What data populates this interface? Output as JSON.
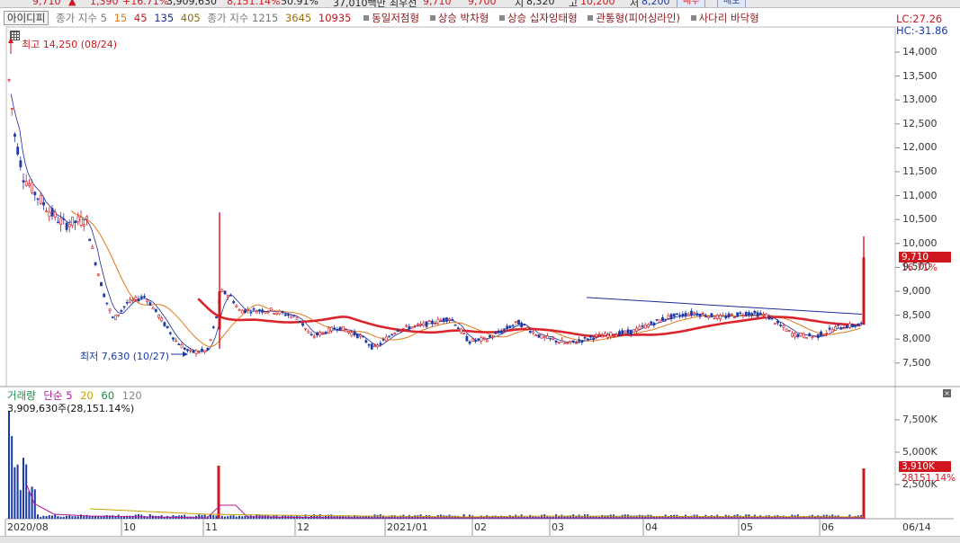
{
  "topbar": {
    "price": "9,710",
    "change": "1,390",
    "change_pct": "+16.71%",
    "volume": "3,909,630",
    "volume_pct": "8,151.14%",
    "ratio": "50.91%",
    "amount": "37,010백만",
    "label_price": "최우선",
    "ask": "9,710",
    "bid": "9,700",
    "open_label": "시",
    "open": "8,320",
    "high_label": "고",
    "high": "10,200",
    "low_label": "저",
    "low": "8,200",
    "buy_btn": "매수",
    "sell_btn": "매도"
  },
  "legend": {
    "tab": "아이디피",
    "ma_label": "종가 지수 5",
    "ma": [
      "15",
      "45",
      "135",
      "405"
    ],
    "ma2_label": "종가 지수 1215",
    "ma2": [
      "3645",
      "10935"
    ],
    "patterns": [
      "동일저점형",
      "상승 박차형",
      "상승 십자잉태형",
      "관통형(피어싱라인)",
      "사다리 바닥형"
    ]
  },
  "annotations": {
    "high": "최고 14,250 (08/24)",
    "low": "최저 7,630 (10/27)"
  },
  "right_info": {
    "lc": "LC:27.26",
    "hc": "HC:-31.86"
  },
  "price_axis": [
    "14,000",
    "13,500",
    "13,000",
    "12,500",
    "12,000",
    "11,500",
    "11,000",
    "10,500",
    "10,000",
    "9,500",
    "9,000",
    "8,500",
    "8,000",
    "7,500"
  ],
  "price_badge": {
    "value": "9,710",
    "pct": "16.71%"
  },
  "volume_panel": {
    "title": "거래량",
    "ma_label": "단순 5",
    "ma": [
      "20",
      "60",
      "120"
    ],
    "info": "3,909,630주(28,151.14%)",
    "axis": [
      "7,500K",
      "5,000K",
      "2,500K"
    ],
    "badge_value": "3,910K",
    "badge_pct": "28151.14%"
  },
  "x_axis": [
    {
      "label": "2020/08"
    },
    {
      "label": "10"
    },
    {
      "label": "11"
    },
    {
      "label": "12"
    },
    {
      "label": "2021/01"
    },
    {
      "label": "02"
    },
    {
      "label": "03"
    },
    {
      "label": "04"
    },
    {
      "label": "05"
    },
    {
      "label": "06"
    },
    {
      "label": "06/14"
    }
  ],
  "colors": {
    "up": "#d0161e",
    "down": "#1c3aa8",
    "ma_red": "#d9252b",
    "ma_blue": "#1c2a9c",
    "ma_orange": "#e07a1d"
  }
}
